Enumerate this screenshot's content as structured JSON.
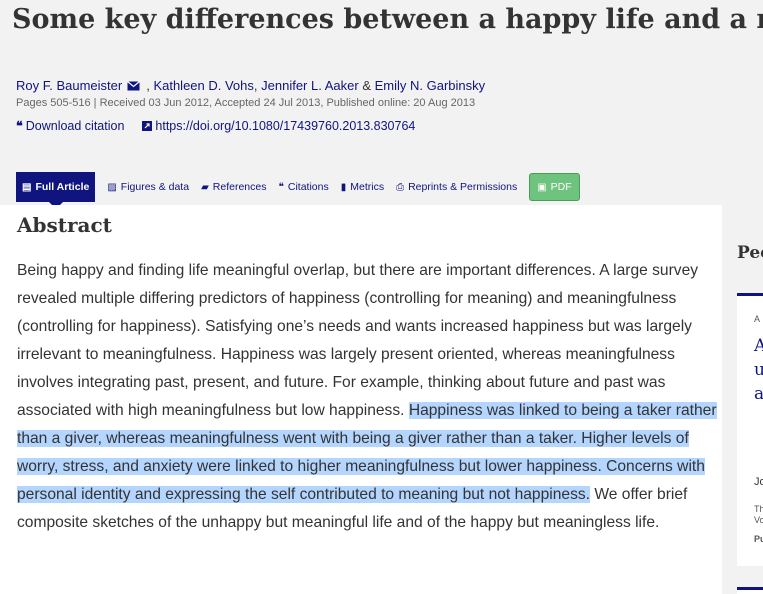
{
  "article": {
    "title": "Some key differences between a happy life and a meaningful life",
    "authors": [
      {
        "name": "Roy F. Baumeister",
        "separator": ", "
      },
      {
        "name": "Kathleen D. Vohs",
        "separator": ", "
      },
      {
        "name": "Jennifer L. Aaker",
        "separator": " & "
      },
      {
        "name": "Emily N. Garbinsky",
        "separator": ""
      }
    ],
    "pub_meta": "Pages 505-516 | Received 03 Jun 2012, Accepted 24 Jul 2013, Published online: 20 Aug 2013",
    "download_citation": "Download citation",
    "doi_link": "https://doi.org/10.1080/17439760.2013.830764"
  },
  "tabs": [
    {
      "label": "Full Article",
      "icon": "document-icon",
      "active": true
    },
    {
      "label": "Figures & data",
      "icon": "image-icon"
    },
    {
      "label": "References",
      "icon": "book-icon"
    },
    {
      "label": "Citations",
      "icon": "quote-icon"
    },
    {
      "label": "Metrics",
      "icon": "bar-chart-icon"
    },
    {
      "label": "Reprints & Permissions",
      "icon": "print-icon"
    },
    {
      "label": "PDF",
      "icon": "pdf-icon"
    }
  ],
  "abstract": {
    "heading": "Abstract",
    "text_before": "Being happy and finding life meaningful overlap, but there are important differences. A large survey revealed multiple differing predictors of happiness (controlling for meaning) and meaningfulness (controlling for happiness). Satisfying one’s needs and wants increased happiness but was largely irrelevant to meaningfulness. Happiness was largely present oriented, whereas meaningfulness involves integrating past, present, and future. For example, thinking about future and past was associated with high meaningfulness but low happiness. ",
    "text_highlighted": "Happiness was linked to being a taker rather than a giver, whereas meaningfulness went with being a giver rather than a taker. Higher levels of worry, stress, and anxiety were linked to higher meaningfulness but lower happiness. Concerns with personal identity and expressing the self contributed to meaning but not happiness.",
    "text_after": " We offer brief composite sketches of the unhappy but meaningful life and of the happy but meaningless life."
  },
  "sidebar": {
    "heading": "Peo",
    "card_label": "A",
    "card_link_1": "A",
    "card_link_2": "u",
    "card_link_3": "a",
    "card_text_1": "Jo",
    "card_text_2": "Th",
    "card_text_3": "Vo",
    "card_text_4": "Pu"
  },
  "colors": {
    "brand_navy": "#10147e",
    "pdf_green": "#6ec37e",
    "highlight": "#b4d5fe"
  }
}
